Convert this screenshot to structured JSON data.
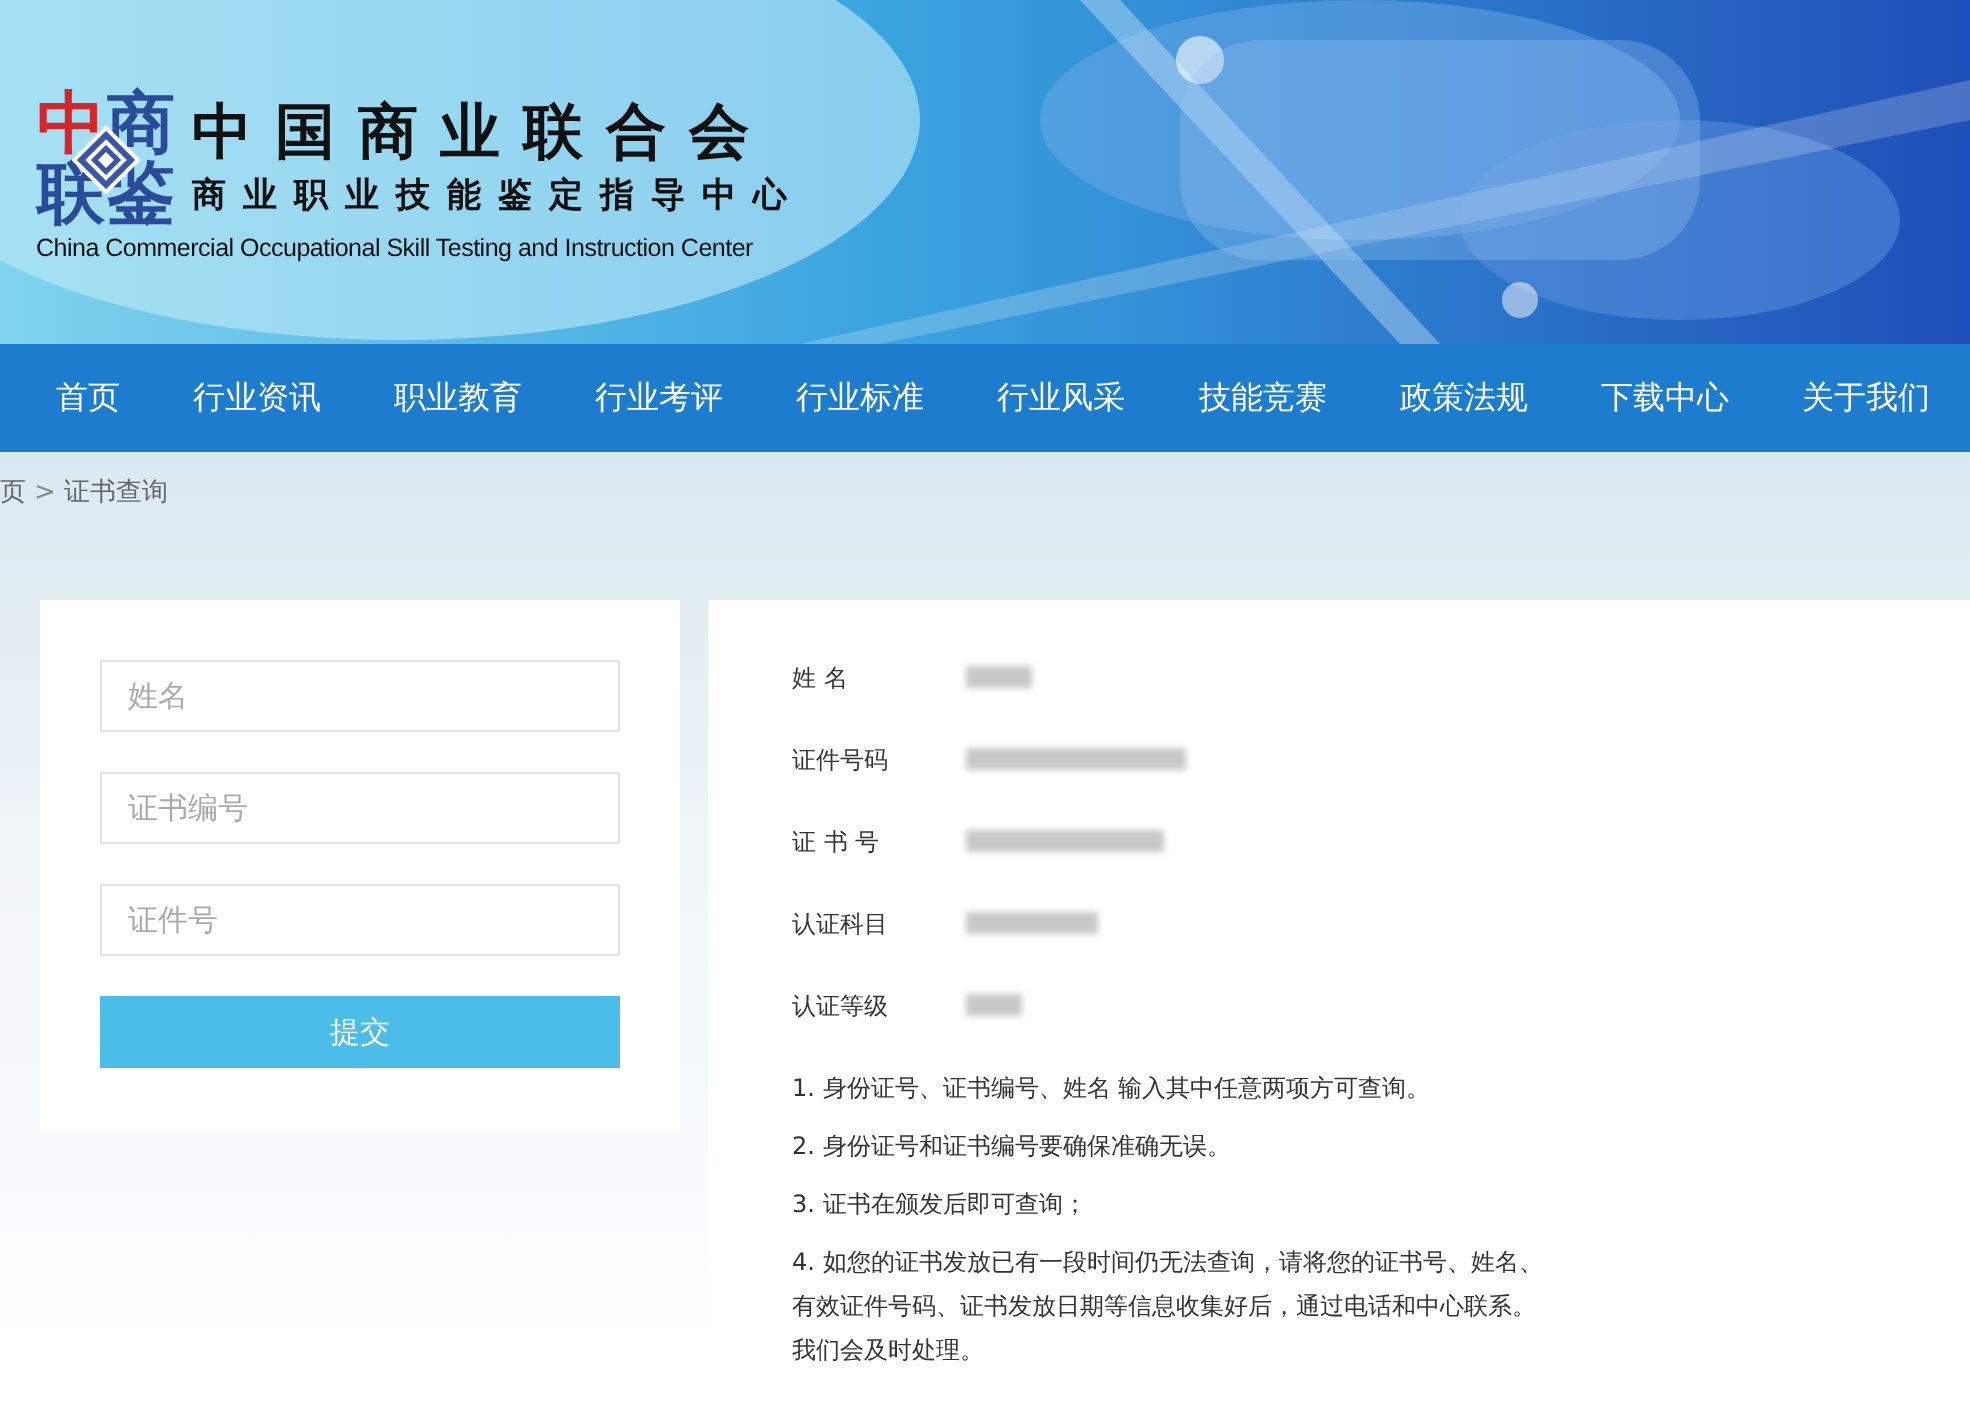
{
  "header": {
    "logo_chars": [
      {
        "text": "中",
        "color": "#d7262b"
      },
      {
        "text": "商",
        "color": "#2a4a9a"
      },
      {
        "text": "联",
        "color": "#2a4a9a"
      },
      {
        "text": "鉴",
        "color": "#2a4a9a"
      }
    ],
    "title": "中国商业联合会",
    "subtitle": "商业职业技能鉴定指导中心",
    "english_name": "China Commercial Occupational Skill Testing and Instruction Center"
  },
  "nav": [
    {
      "label": "首页",
      "selected": false
    },
    {
      "label": "行业资讯",
      "selected": false
    },
    {
      "label": "职业教育",
      "selected": false
    },
    {
      "label": "行业考评",
      "selected": false
    },
    {
      "label": "行业标准",
      "selected": false
    },
    {
      "label": "行业风采",
      "selected": false
    },
    {
      "label": "技能竞赛",
      "selected": false
    },
    {
      "label": "政策法规",
      "selected": false
    },
    {
      "label": "下载中心",
      "selected": false
    },
    {
      "label": "关于我们",
      "selected": false
    }
  ],
  "breadcrumb": {
    "items": [
      "页",
      "证书查询"
    ],
    "separator": ">"
  },
  "query_form": {
    "fields": [
      {
        "placeholder": "姓名"
      },
      {
        "placeholder": "证书编号"
      },
      {
        "placeholder": "证件号"
      }
    ],
    "submit": "提交"
  },
  "result": {
    "rows": [
      {
        "label": "姓 名",
        "redacted": true
      },
      {
        "label": "证件号码",
        "redacted": true
      },
      {
        "label": "证 书 号",
        "redacted": true
      },
      {
        "label": "认证科目",
        "redacted": true
      },
      {
        "label": "认证等级",
        "redacted": true
      }
    ],
    "notes": [
      "1. 身份证号、证书编号、姓名 输入其中任意两项方可查询。",
      "2. 身份证号和证书编号要确保准确无误。",
      "3. 证书在颁发后即可查询；",
      "4. 如您的证书发放已有一段时间仍无法查询，请将您的证书号、姓名、有效证件号码、证书发放日期等信息收集好后，通过电话和中心联系。我们会及时处理。"
    ]
  }
}
